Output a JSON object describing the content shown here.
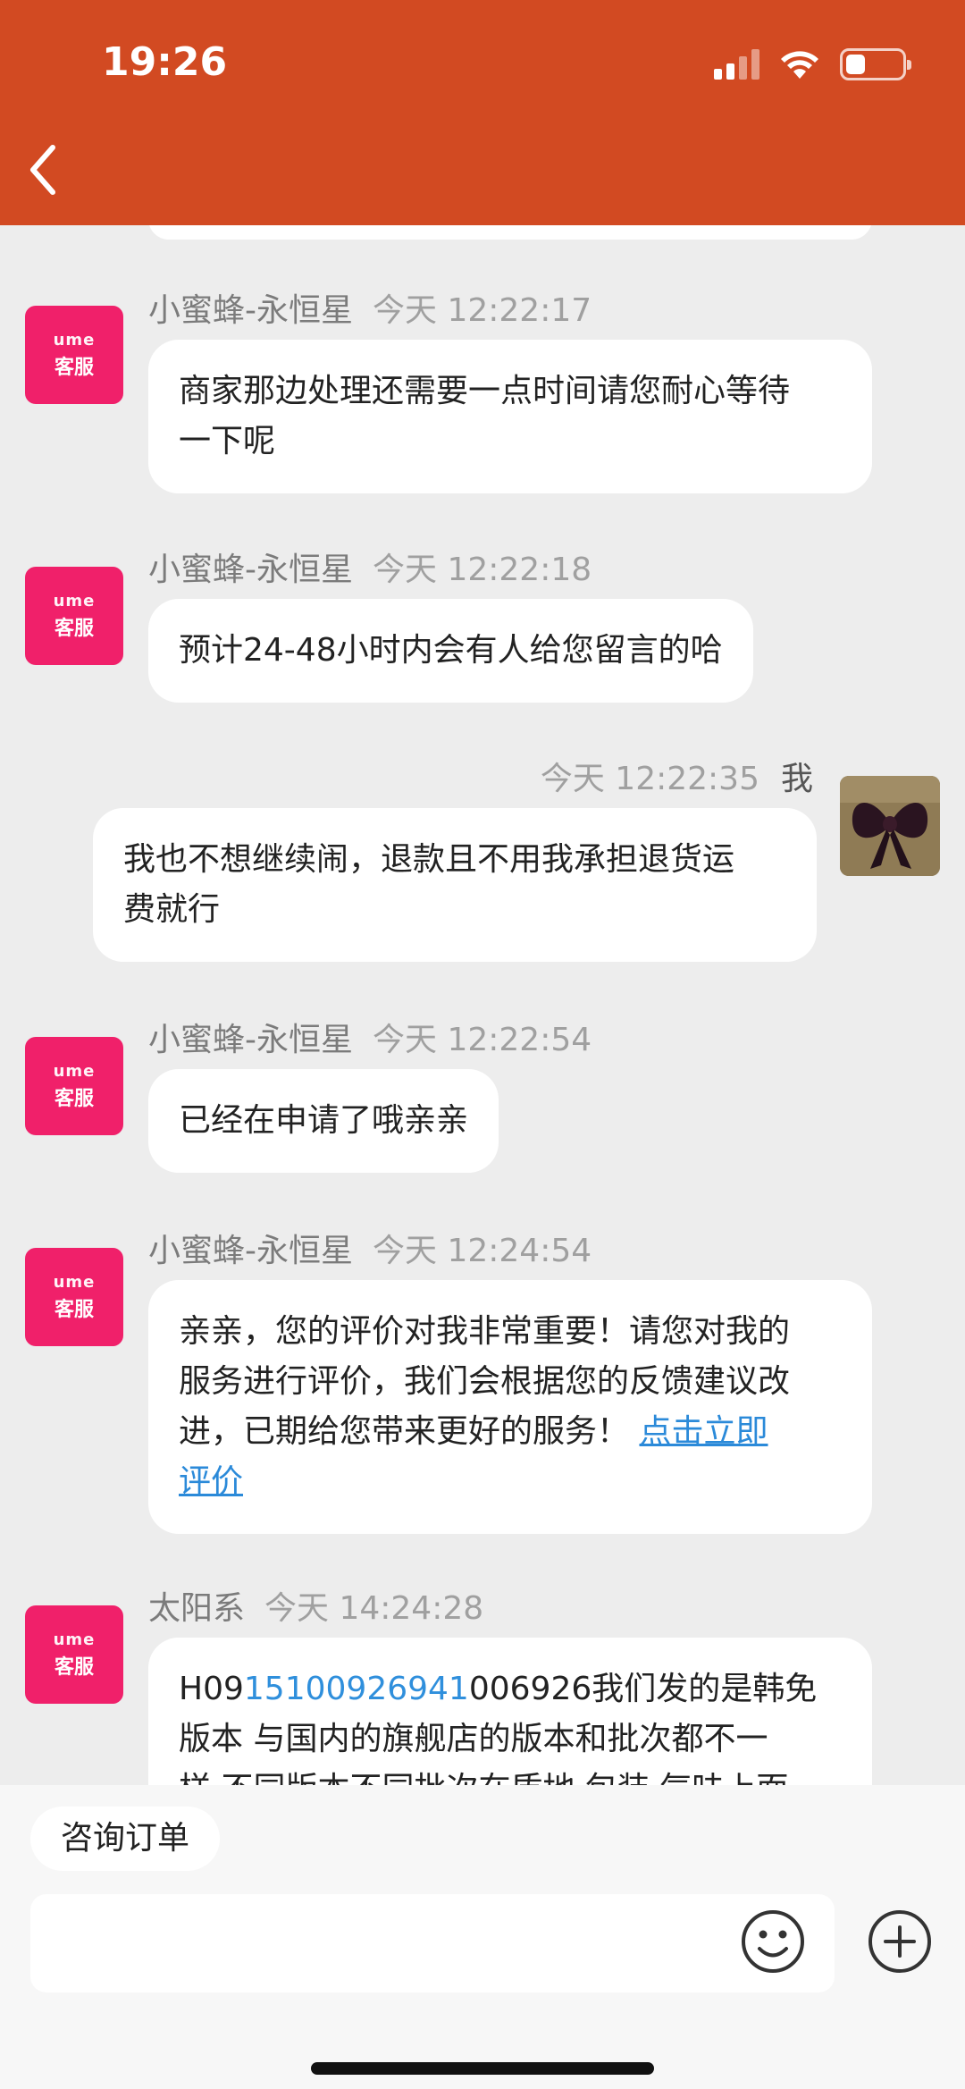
{
  "status_bar": {
    "time": "19:26",
    "battery_level": 0.35
  },
  "colors": {
    "header": "#d24a22",
    "cs_avatar": "#f0206a",
    "link": "#2b8ad9"
  },
  "cs_avatar": {
    "brand": "ume",
    "label": "客服"
  },
  "messages": [
    {
      "sender": "小蜜蜂-永恒星",
      "time": "今天 12:22:17",
      "lines": [
        "商家那边处理还需要一点时间请您耐心等待",
        "一下呢"
      ]
    },
    {
      "sender": "小蜜蜂-永恒星",
      "time": "今天 12:22:18",
      "lines": [
        "预计24-48小时内会有人给您留言的哈"
      ]
    },
    {
      "sender": "我",
      "time": "今天 12:22:35",
      "lines": [
        "我也不想继续闹，退款且不用我承担退货运",
        "费就行"
      ]
    },
    {
      "sender": "小蜜蜂-永恒星",
      "time": "今天 12:22:54",
      "lines": [
        "已经在申请了哦亲亲"
      ]
    },
    {
      "sender": "小蜜蜂-永恒星",
      "time": "今天 12:24:54",
      "lines": [
        "亲亲，您的评价对我非常重要！请您对我的",
        "服务进行评价，我们会根据您的反馈建议改",
        "进，已期给您带来更好的服务！"
      ],
      "link_part1": "点击立即",
      "link_part2": "评价"
    },
    {
      "sender": "太阳系",
      "time": "今天 14:24:28",
      "line1_prefix": "H09",
      "line1_number": "15100926941",
      "line1_suffix": "006926我们发的是韩免",
      "line2": "版本 与国内的旗舰店的版本和批次都不一",
      "line3": "样 不同版本不同批次在质地 包装 气味上面"
    }
  ],
  "bottom_bar": {
    "quick_reply": "咨询订单",
    "input_value": ""
  }
}
